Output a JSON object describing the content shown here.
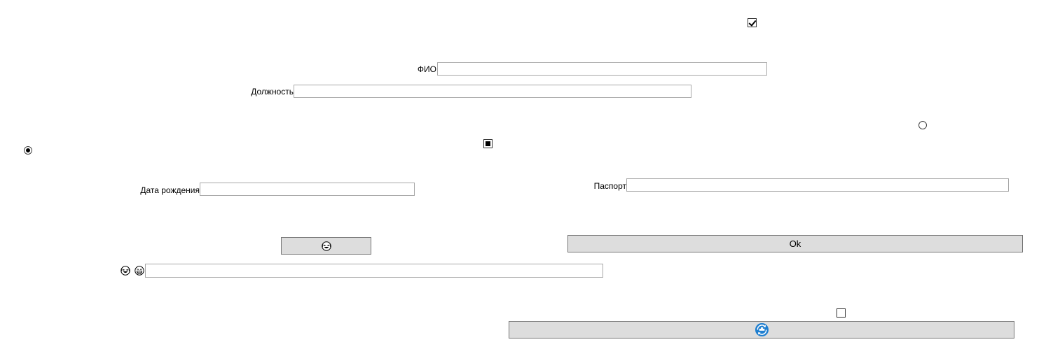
{
  "checkboxes": {
    "top_checkbox_checked": true,
    "middle_checkbox_state": "indeterminate",
    "bottom_checkbox_checked": false
  },
  "radios": {
    "left_radio_checked": true,
    "right_radio_checked": false
  },
  "fields": {
    "fio": {
      "label": "ФИО",
      "value": ""
    },
    "position": {
      "label": "Должность",
      "value": ""
    },
    "birth_date": {
      "label": "Дата рождения",
      "value": ""
    },
    "passport": {
      "label": "Паспорт",
      "value": ""
    },
    "emoji_field": {
      "value": ""
    }
  },
  "buttons": {
    "ok_label": "Ok",
    "emoji_button_icon": "laughing-face-icon",
    "bottom_button_icon": "blue-ship-refresh-icon"
  },
  "icons": {
    "emoji_field_icons": [
      "laughing-face-icon",
      "grinning-face-icon"
    ]
  },
  "colors": {
    "button_bg": "#dddddd",
    "button_border": "#777777",
    "field_border": "#a8a8a8",
    "accent_blue": "#1f7fd0"
  }
}
